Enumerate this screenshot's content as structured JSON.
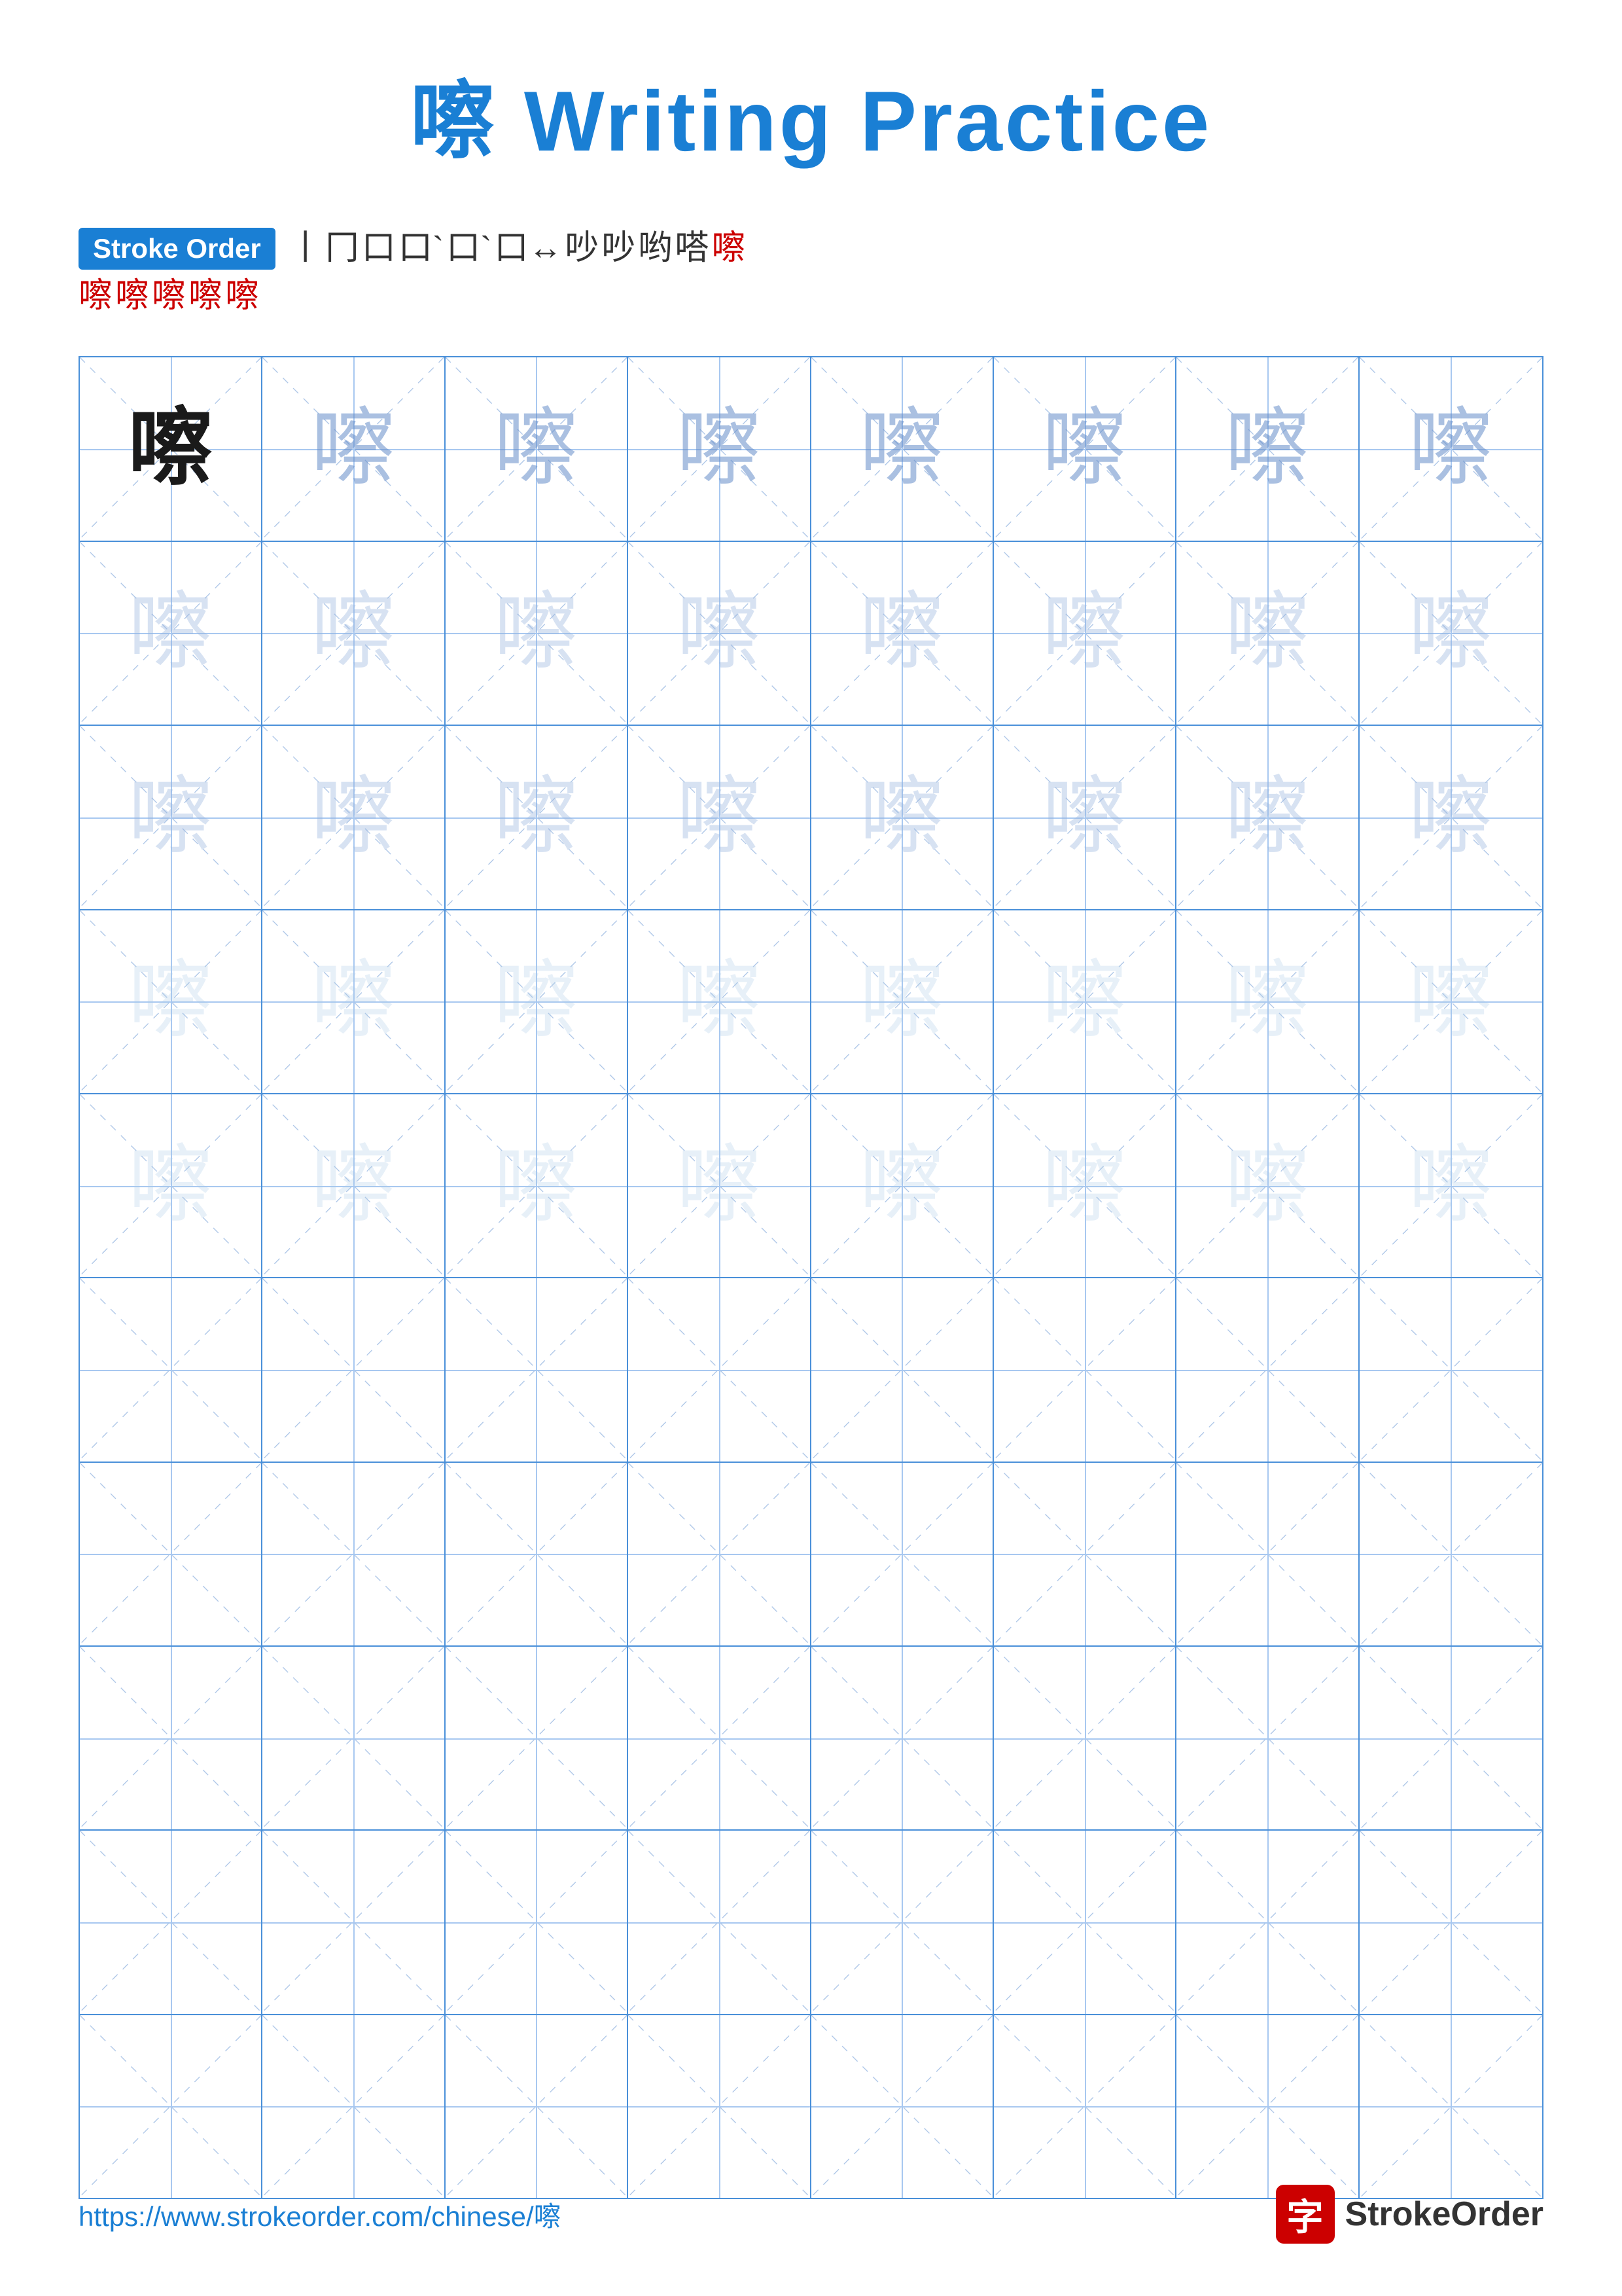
{
  "title": {
    "char": "嚓",
    "text": " Writing Practice",
    "full": "嚓 Writing Practice"
  },
  "stroke_order": {
    "badge_label": "Stroke Order",
    "chars_row1": [
      "丨",
      "冂",
      "口",
      "口`",
      "口`",
      "口↔",
      "口吵",
      "吵",
      "哟",
      "嗒",
      "嚓"
    ],
    "chars_row2": [
      "嚓",
      "嚓",
      "嚓",
      "嚓",
      "嚓"
    ]
  },
  "grid": {
    "rows": 10,
    "cols": 8,
    "character": "嚓"
  },
  "footer": {
    "url": "https://www.strokeorder.com/chinese/嚓",
    "brand_char": "字",
    "brand_name": "StrokeOrder"
  }
}
